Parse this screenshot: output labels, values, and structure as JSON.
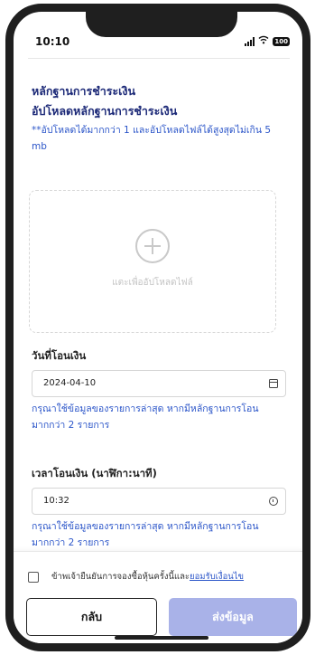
{
  "status_bar": {
    "time": "10:10",
    "battery": "100"
  },
  "payment_proof": {
    "section_title": "หลักฐานการชำระเงิน",
    "upload_title": "อัปโหลดหลักฐานการชำระเงิน",
    "upload_note": "**อัปโหลดได้มากกว่า 1 และอัปโหลดไฟล์ได้สูงสุดไม่เกิน 5 mb",
    "upload_label": "แตะเพื่ออัปโหลดไฟล์"
  },
  "transfer_date": {
    "label": "วันที่โอนเงิน",
    "value": "2024-04-10",
    "hint": "กรุณาใช้ข้อมูลของรายการล่าสุด หากมีหลักฐานการโอนมากกว่า 2 รายการ"
  },
  "transfer_time": {
    "label": "เวลาโอนเงิน (นาฬิกา:นาที)",
    "value": "10:32",
    "hint": "กรุณาใช้ข้อมูลของรายการล่าสุด หากมีหลักฐานการโอนมากกว่า 2 รายการ"
  },
  "consent": {
    "checked": false,
    "text": "ข้าพเจ้ายืนยันการจองซื้อหุ้นครั้งนี้และ",
    "link": "ยอมรับเงื่อนไข"
  },
  "actions": {
    "back_label": "กลับ",
    "submit_label": "ส่งข้อมูล"
  },
  "colors": {
    "heading": "#1d2a78",
    "accent_blue": "#2c56c9",
    "submit_disabled": "#a9b2e8"
  }
}
